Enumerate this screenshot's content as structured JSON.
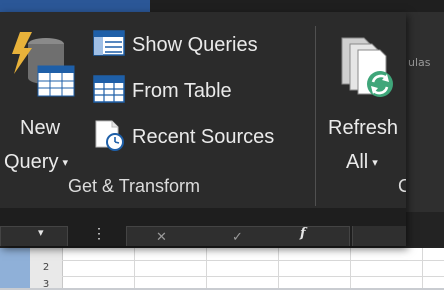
{
  "ribbon": {
    "new_query": {
      "line1": "New",
      "line2": "Query",
      "caret": "▾"
    },
    "items": [
      {
        "label": "Show Queries",
        "icon": "show-queries-icon"
      },
      {
        "label": "From Table",
        "icon": "from-table-icon"
      },
      {
        "label": "Recent Sources",
        "icon": "recent-sources-icon"
      }
    ],
    "group_label": "Get & Transform",
    "refresh_all": {
      "line1": "Refresh",
      "line2": "All",
      "caret": "▾"
    },
    "partial_right": "ulas",
    "partial_group": "C"
  },
  "formula_bar": {
    "fx": "f",
    "cancel": "✕",
    "enter": "✓"
  },
  "grid": {
    "rows": [
      "2",
      "3"
    ]
  },
  "colors": {
    "ribbon_bg": "#2b2b2b",
    "text": "#eaeaea",
    "accent_green": "#3fa67a",
    "accent_blue": "#1e5fa8"
  }
}
